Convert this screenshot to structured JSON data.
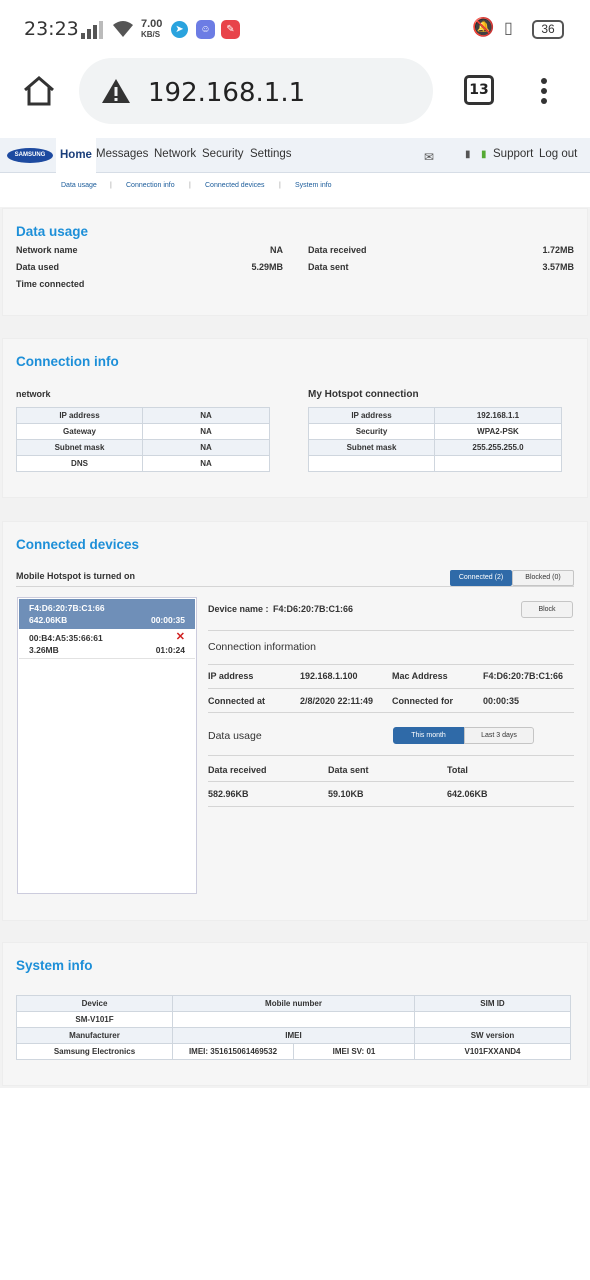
{
  "status_bar": {
    "time": "23:23",
    "net_speed": "7.00",
    "net_unit": "KB/S",
    "battery": "36"
  },
  "browser": {
    "url": "192.168.1.1",
    "tab_count": "13"
  },
  "nav": {
    "logo": "SAMSUNG",
    "items": [
      "Home",
      "Messages",
      "Network",
      "Security",
      "Settings"
    ],
    "support": "Support",
    "logout": "Log out"
  },
  "subnav": [
    "Data usage",
    "Connection info",
    "Connected devices",
    "System info"
  ],
  "data_usage": {
    "title": "Data usage",
    "network_name_label": "Network name",
    "network_name": "NA",
    "data_used_label": "Data used",
    "data_used": "5.29MB",
    "time_connected_label": "Time connected",
    "data_received_label": "Data received",
    "data_received": "1.72MB",
    "data_sent_label": "Data sent",
    "data_sent": "3.57MB"
  },
  "connection_info": {
    "title": "Connection info",
    "network_title": "network",
    "network_rows": [
      [
        "IP address",
        "NA"
      ],
      [
        "Gateway",
        "NA"
      ],
      [
        "Subnet mask",
        "NA"
      ],
      [
        "DNS",
        "NA"
      ]
    ],
    "hotspot_title": "My Hotspot connection",
    "hotspot_rows": [
      [
        "IP address",
        "192.168.1.1"
      ],
      [
        "Security",
        "WPA2-PSK"
      ],
      [
        "Subnet mask",
        "255.255.255.0"
      ],
      [
        "",
        ""
      ]
    ]
  },
  "connected_devices": {
    "title": "Connected devices",
    "hotspot_status": "Mobile Hotspot is turned on",
    "tab_connected": "Connected (2)",
    "tab_blocked": "Blocked (0)",
    "devices": [
      {
        "mac": "F4:D6:20:7B:C1:66",
        "size": "642.06KB",
        "time": "00:00:35"
      },
      {
        "mac": "00:B4:A5:35:66:61",
        "size": "3.26MB",
        "time": "01:0:24"
      }
    ],
    "device_name_label": "Device name :",
    "device_name": "F4:D6:20:7B:C1:66",
    "block_label": "Block",
    "conn_info_title": "Connection information",
    "ip_label": "IP address",
    "ip": "192.168.1.100",
    "mac_label": "Mac Address",
    "mac": "F4:D6:20:7B:C1:66",
    "connected_at_label": "Connected at",
    "connected_at": "2/8/2020 22:11:49",
    "connected_for_label": "Connected for",
    "connected_for": "00:00:35",
    "usage_title": "Data usage",
    "this_month": "This month",
    "last_3_days": "Last 3 days",
    "col_received": "Data received",
    "col_sent": "Data sent",
    "col_total": "Total",
    "received": "582.96KB",
    "sent": "59.10KB",
    "total": "642.06KB"
  },
  "system_info": {
    "title": "System info",
    "device_label": "Device",
    "mobile_label": "Mobile number",
    "sim_label": "SIM ID",
    "device": "SM-V101F",
    "mobile": "",
    "sim": "",
    "manufacturer_label": "Manufacturer",
    "imei_label": "IMEI",
    "sw_label": "SW version",
    "manufacturer": "Samsung Electronics",
    "imei": "IMEI: 351615061469532",
    "imei_sv": "IMEI SV: 01",
    "sw": "V101FXXAND4"
  }
}
